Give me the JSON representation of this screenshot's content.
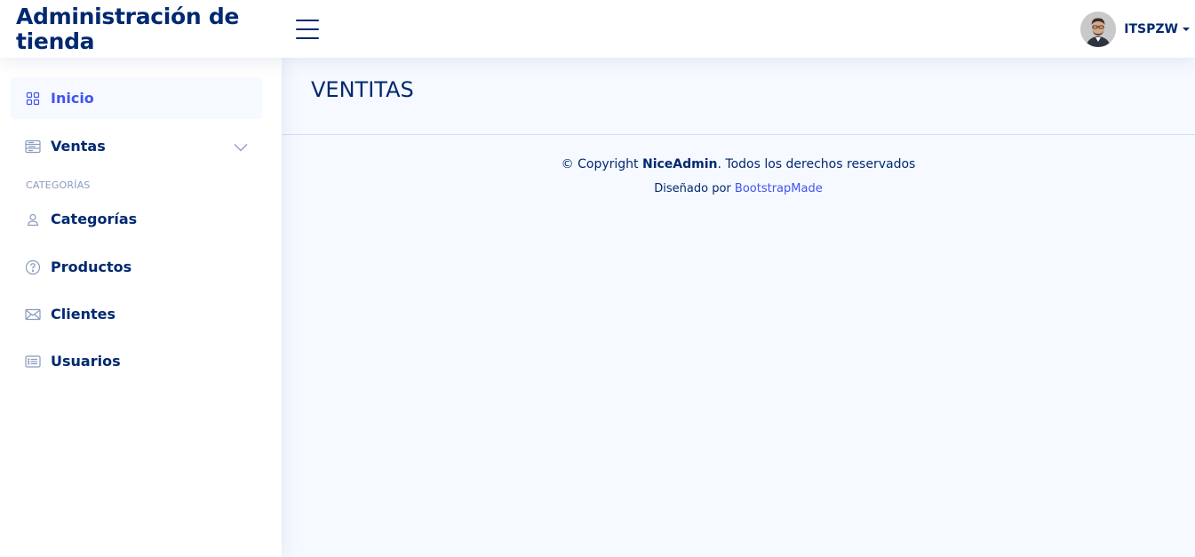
{
  "header": {
    "logo_text": "Administración de tienda",
    "user_name": "ITSPZW"
  },
  "sidebar": {
    "items": [
      {
        "label": "Inicio",
        "icon": "grid-icon",
        "active": true
      },
      {
        "label": "Ventas",
        "icon": "layout-text-icon"
      },
      {
        "label": "Categorías",
        "icon": "person-icon"
      },
      {
        "label": "Productos",
        "icon": "question-circle-icon"
      },
      {
        "label": "Clientes",
        "icon": "envelope-icon"
      },
      {
        "label": "Usuarios",
        "icon": "card-list-icon"
      }
    ],
    "section_heading": "CATEGORÍAS"
  },
  "main": {
    "title": "VENTITAS"
  },
  "footer": {
    "copyright_prefix": "© Copyright ",
    "brand": "NiceAdmin",
    "copyright_suffix": ". Todos los derechos reservados",
    "credits_prefix": "Diseñado por ",
    "credits_link": "BootstrapMade"
  },
  "colors": {
    "primary": "#012970",
    "accent": "#4154f1",
    "background": "#f6f9ff",
    "muted": "#899bbd"
  }
}
